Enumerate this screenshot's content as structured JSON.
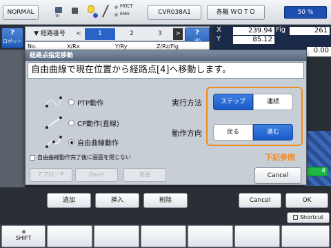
{
  "topbar": {
    "mode": "NORMAL",
    "tp_label": "TP",
    "prtct_label": "PRTCT",
    "emg_label": "EMG",
    "controller": "CVR038A1",
    "axes": "各軸 ＷＯＴＯ",
    "progress_label": "50 %",
    "progress_value": 50
  },
  "left": {
    "robot_btn": "ロボット",
    "q": "?"
  },
  "tabs": {
    "name": "▼ 経路番号",
    "prev": "<",
    "items": [
      "1",
      "2",
      "3"
    ],
    "next": ">"
  },
  "view3d": {
    "q": "?",
    "label": "3D"
  },
  "coords": {
    "x_label": "X",
    "x_value": "239.94",
    "y_label": "Y",
    "y_value": "85.12",
    "fig_label": "Fig",
    "fig_value": "261",
    "extra_value": "0.00"
  },
  "table_header": [
    "No.",
    "X/Rx",
    "Y/Ry",
    "Z/Rz/Fig"
  ],
  "dialog": {
    "title": "経路点指定移動",
    "message": "自由曲線で現在位置から経路点[4]へ移動します。",
    "options": [
      "PTP動作",
      "CP動作(直線)",
      "自由曲線動作"
    ],
    "selected_option": 2,
    "checkbox_label": "自由曲線動作完了後に画面を閉じない",
    "method_label": "実行方法",
    "method_options": [
      "ステップ",
      "連続"
    ],
    "method_selected": 0,
    "direction_label": "動作方向",
    "direction_options": [
      "戻る",
      "進む"
    ],
    "direction_selected": 1,
    "approach": "アプローチ",
    "depart": "DevH",
    "change": "変更",
    "cancel": "Cancel",
    "callout": "下記参照"
  },
  "scene_value": "4",
  "actions": {
    "add": "追加",
    "insert": "挿入",
    "delete": "削除",
    "cancel": "Cancel",
    "ok": "OK"
  },
  "shortcut": "Shortcut",
  "fkeys": {
    "shift": "SHIFT"
  },
  "colors": {
    "accent": "#1a5ac8",
    "callout": "#f08a1c"
  }
}
